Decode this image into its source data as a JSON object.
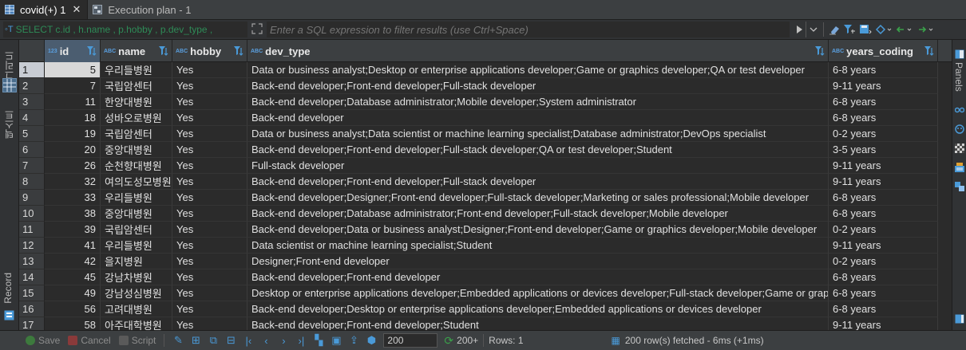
{
  "tabs": [
    {
      "label": "covid(+) 1",
      "close": "✕",
      "active": true
    },
    {
      "label": "Execution plan - 1",
      "active": false
    }
  ],
  "filter": {
    "prefix_icon": "◦T",
    "sql_prefix": "SELECT c.id , h.name , p.hobby , p.dev_type ,",
    "placeholder": "Enter a SQL expression to filter results (use Ctrl+Space)"
  },
  "left_panel": {
    "grid_label": "그리드",
    "text_label": "텍스트",
    "record_label": "Record"
  },
  "right_panel": {
    "panels_label": "Panels"
  },
  "columns": [
    {
      "key": "id",
      "label": "id",
      "type": "123"
    },
    {
      "key": "name",
      "label": "name",
      "type": "ABC"
    },
    {
      "key": "hobby",
      "label": "hobby",
      "type": "ABC"
    },
    {
      "key": "dev_type",
      "label": "dev_type",
      "type": "ABC"
    },
    {
      "key": "years_coding",
      "label": "years_coding",
      "type": "ABC"
    }
  ],
  "rows": [
    {
      "n": "1",
      "id": "5",
      "name": "우리들병원",
      "hobby": "Yes",
      "dev_type": "Data or business analyst;Desktop or enterprise applications developer;Game or graphics developer;QA or test developer",
      "years_coding": "6-8 years"
    },
    {
      "n": "2",
      "id": "7",
      "name": "국립암센터",
      "hobby": "Yes",
      "dev_type": "Back-end developer;Front-end developer;Full-stack developer",
      "years_coding": "9-11 years"
    },
    {
      "n": "3",
      "id": "11",
      "name": "한양대병원",
      "hobby": "Yes",
      "dev_type": "Back-end developer;Database administrator;Mobile developer;System administrator",
      "years_coding": "6-8 years"
    },
    {
      "n": "4",
      "id": "18",
      "name": "성바오로병원",
      "hobby": "Yes",
      "dev_type": "Back-end developer",
      "years_coding": "6-8 years"
    },
    {
      "n": "5",
      "id": "19",
      "name": "국립암센터",
      "hobby": "Yes",
      "dev_type": "Data or business analyst;Data scientist or machine learning specialist;Database administrator;DevOps specialist",
      "years_coding": "0-2 years"
    },
    {
      "n": "6",
      "id": "20",
      "name": "중앙대병원",
      "hobby": "Yes",
      "dev_type": "Back-end developer;Front-end developer;Full-stack developer;QA or test developer;Student",
      "years_coding": "3-5 years"
    },
    {
      "n": "7",
      "id": "26",
      "name": "순천향대병원",
      "hobby": "Yes",
      "dev_type": "Full-stack developer",
      "years_coding": "9-11 years"
    },
    {
      "n": "8",
      "id": "32",
      "name": "여의도성모병원",
      "hobby": "Yes",
      "dev_type": "Back-end developer;Front-end developer;Full-stack developer",
      "years_coding": "9-11 years"
    },
    {
      "n": "9",
      "id": "33",
      "name": "우리들병원",
      "hobby": "Yes",
      "dev_type": "Back-end developer;Designer;Front-end developer;Full-stack developer;Marketing or sales professional;Mobile developer",
      "years_coding": "6-8 years"
    },
    {
      "n": "10",
      "id": "38",
      "name": "중앙대병원",
      "hobby": "Yes",
      "dev_type": "Back-end developer;Database administrator;Front-end developer;Full-stack developer;Mobile developer",
      "years_coding": "6-8 years"
    },
    {
      "n": "11",
      "id": "39",
      "name": "국립암센터",
      "hobby": "Yes",
      "dev_type": "Back-end developer;Data or business analyst;Designer;Front-end developer;Game or graphics developer;Mobile developer",
      "years_coding": "0-2 years"
    },
    {
      "n": "12",
      "id": "41",
      "name": "우리들병원",
      "hobby": "Yes",
      "dev_type": "Data scientist or machine learning specialist;Student",
      "years_coding": "9-11 years"
    },
    {
      "n": "13",
      "id": "42",
      "name": "을지병원",
      "hobby": "Yes",
      "dev_type": "Designer;Front-end developer",
      "years_coding": "0-2 years"
    },
    {
      "n": "14",
      "id": "45",
      "name": "강남차병원",
      "hobby": "Yes",
      "dev_type": "Back-end developer;Front-end developer",
      "years_coding": "6-8 years"
    },
    {
      "n": "15",
      "id": "49",
      "name": "강남성심병원",
      "hobby": "Yes",
      "dev_type": "Desktop or enterprise applications developer;Embedded applications or devices developer;Full-stack developer;Game or graphics developer",
      "years_coding": "6-8 years"
    },
    {
      "n": "16",
      "id": "56",
      "name": "고려대병원",
      "hobby": "Yes",
      "dev_type": "Back-end developer;Desktop or enterprise applications developer;Embedded applications or devices developer",
      "years_coding": "6-8 years"
    },
    {
      "n": "17",
      "id": "58",
      "name": "아주대학병원",
      "hobby": "Yes",
      "dev_type": "Back-end developer;Front-end developer;Student",
      "years_coding": "9-11 years"
    }
  ],
  "status": {
    "save": "Save",
    "cancel": "Cancel",
    "script": "Script",
    "fetch_size": "200",
    "fetch_all": "200+",
    "rows": "Rows: 1",
    "fetched": "200 row(s) fetched - 6ms (+1ms)"
  },
  "colors": {
    "accent": "#4a9ad8",
    "selection": "#d8d8d8",
    "green": "#3aa04a"
  }
}
